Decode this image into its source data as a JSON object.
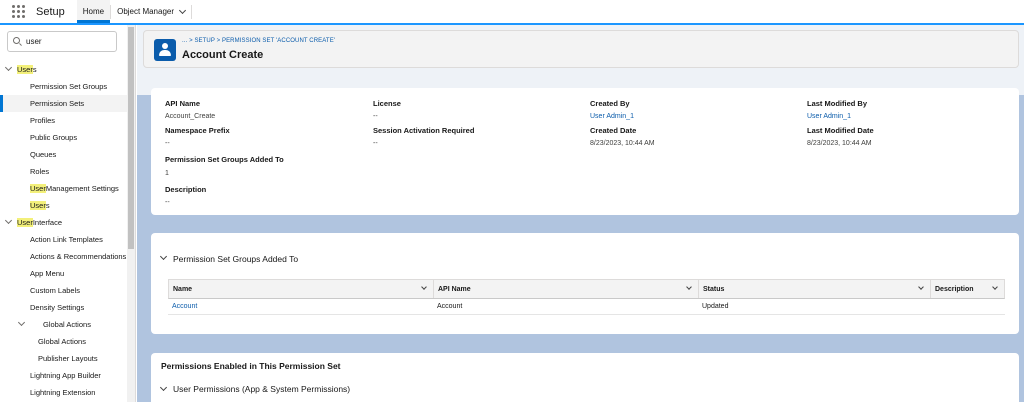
{
  "topbar": {
    "app_name": "Setup",
    "tabs": [
      {
        "label": "Home"
      },
      {
        "label": "Object Manager"
      }
    ]
  },
  "sidebar": {
    "search_value": "user",
    "items": [
      {
        "label_pre": "",
        "label_hl": "User",
        "label_post": "s"
      },
      {
        "label": "Permission Set Groups"
      },
      {
        "label": "Permission Sets"
      },
      {
        "label": "Profiles"
      },
      {
        "label": "Public Groups"
      },
      {
        "label": "Queues"
      },
      {
        "label": "Roles"
      },
      {
        "label_hl": "User",
        "label_post": " Management Settings"
      },
      {
        "label_hl": "User",
        "label_post": "s"
      },
      {
        "label_hl": "User",
        "label_post": " Interface"
      },
      {
        "label": "Action Link Templates"
      },
      {
        "label": "Actions & Recommendations"
      },
      {
        "label": "App Menu"
      },
      {
        "label": "Custom Labels"
      },
      {
        "label": "Density Settings"
      },
      {
        "label": "Global Actions"
      },
      {
        "label": "Global Actions"
      },
      {
        "label": "Publisher Layouts"
      },
      {
        "label": "Lightning App Builder"
      },
      {
        "label": "Lightning Extension"
      }
    ]
  },
  "header": {
    "breadcrumb": "... > SETUP > PERMISSION SET 'ACCOUNT CREATE'",
    "title": "Account Create"
  },
  "details": {
    "api_name_label": "API Name",
    "api_name_value": "Account_Create",
    "license_label": "License",
    "license_value": "--",
    "created_by_label": "Created By",
    "created_by_value": "User Admin_1",
    "last_modified_by_label": "Last Modified By",
    "last_modified_by_value": "User Admin_1",
    "namespace_label": "Namespace Prefix",
    "namespace_value": "--",
    "session_label": "Session Activation Required",
    "session_value": "--",
    "created_date_label": "Created Date",
    "created_date_value": "8/23/2023, 10:44 AM",
    "last_modified_date_label": "Last Modified Date",
    "last_modified_date_value": "8/23/2023, 10:44 AM",
    "psg_added_label": "Permission Set Groups Added To",
    "psg_added_value": "1",
    "description_label": "Description",
    "description_value": "--"
  },
  "groups_section": {
    "title": "Permission Set Groups Added To",
    "columns": [
      "Name",
      "API Name",
      "Status",
      "Description"
    ],
    "rows": [
      {
        "name": "Account",
        "api_name": "Account",
        "status": "Updated",
        "description": ""
      }
    ]
  },
  "permissions_section": {
    "title": "Permissions Enabled in This Permission Set",
    "subsection": "User Permissions (App & System Permissions)"
  }
}
